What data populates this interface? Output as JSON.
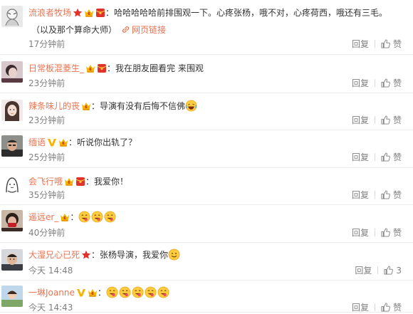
{
  "comments": [
    {
      "username": "流浪者牧场",
      "badges": [
        "star-red-icon",
        "vip-crown-icon",
        "red-envelope-icon"
      ],
      "text": "哈哈哈哈哈前排围观一下。心疼张杨，哦不对，心疼荷西，哦还有三毛。",
      "text_line2": "（以及那个算命大师）",
      "link_label": "网页链接",
      "time": "17分钟前",
      "reply_label": "回复",
      "like_label": "赞",
      "like_count": ""
    },
    {
      "username": "日常板混菱生_",
      "badges": [
        "vip-crown-icon",
        "red-envelope-icon"
      ],
      "text": "我在朋友圈看完 来围观",
      "time": "23分钟前",
      "reply_label": "回复",
      "like_label": "赞",
      "like_count": ""
    },
    {
      "username": "辣条味儿的丧",
      "badges": [
        "vip-crown-icon"
      ],
      "text": "导演有没有后悔不信佛",
      "emojis": [
        "laugh-cry-emoji"
      ],
      "time": "23分钟前",
      "reply_label": "回复",
      "like_label": "赞",
      "like_count": ""
    },
    {
      "username": "缅语",
      "badges": [
        "verified-v-icon",
        "vip-crown-icon"
      ],
      "text": "听说你出轨了？",
      "time": "25分钟前",
      "reply_label": "回复",
      "like_label": "赞",
      "like_count": ""
    },
    {
      "username": "会飞行哦",
      "badges": [
        "vip-crown-icon",
        "red-envelope-icon"
      ],
      "text": "我爱你！",
      "time": "35分钟前",
      "reply_label": "回复",
      "like_label": "赞",
      "like_count": ""
    },
    {
      "username": "遥远er_",
      "badges": [
        "vip-crown-icon"
      ],
      "text": "",
      "emojis": [
        "yummy-emoji",
        "yummy-emoji",
        "yummy-emoji"
      ],
      "time": "40分钟前",
      "reply_label": "回复",
      "like_label": "赞",
      "like_count": ""
    },
    {
      "username": "大湿兄心已死",
      "badges": [
        "star-red-icon"
      ],
      "text": "张杨导演，我爱你",
      "emojis": [
        "smile-emoji"
      ],
      "time": "今天 14:48",
      "reply_label": "回复",
      "like_label": "赞",
      "like_count": "3"
    },
    {
      "username": "一琳Joanne",
      "badges": [
        "verified-v-icon",
        "vip-crown-icon"
      ],
      "text": "",
      "emojis": [
        "yummy-emoji",
        "yummy-emoji",
        "yummy-emoji",
        "yummy-emoji",
        "yummy-emoji"
      ],
      "time": "今天 14:43",
      "reply_label": "回复",
      "like_label": "赞",
      "like_count": ""
    }
  ],
  "colors": {
    "username": "#eb7350",
    "text": "#333333",
    "meta": "#808080",
    "divider": "#ececec",
    "star_badge": "#e0322b",
    "vip_badge": "#f4b400",
    "verified_badge": "#f6b400"
  }
}
